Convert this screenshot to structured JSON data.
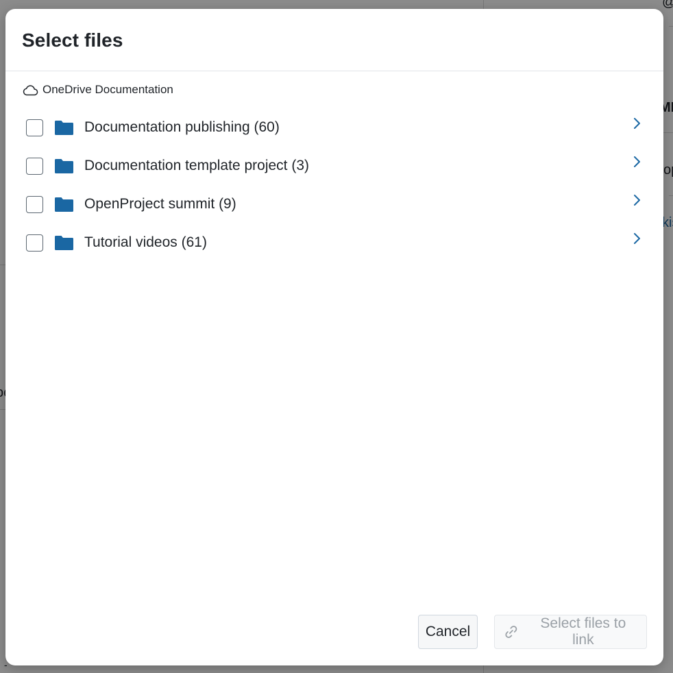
{
  "dialog": {
    "title": "Select files",
    "location": {
      "icon": "cloud-icon",
      "label": "OneDrive Documentation"
    },
    "items": [
      {
        "name": "Documentation publishing (60)",
        "type": "folder",
        "checked": false
      },
      {
        "name": "Documentation template project (3)",
        "type": "folder",
        "checked": false
      },
      {
        "name": "OpenProject summit (9)",
        "type": "folder",
        "checked": false
      },
      {
        "name": "Tutorial videos (61)",
        "type": "folder",
        "checked": false
      }
    ],
    "footer": {
      "cancel_label": "Cancel",
      "link_label": "Select files to link",
      "link_disabled": true
    }
  },
  "background": {
    "fragments": [
      "@",
      "MB",
      "op",
      "kis",
      "oc",
      "-"
    ]
  },
  "colors": {
    "folder": "#1a67a3",
    "chevron": "#1a67a3",
    "disabled_text": "#9aa0a6",
    "overlay": "rgba(0,0,0,0.45)"
  }
}
